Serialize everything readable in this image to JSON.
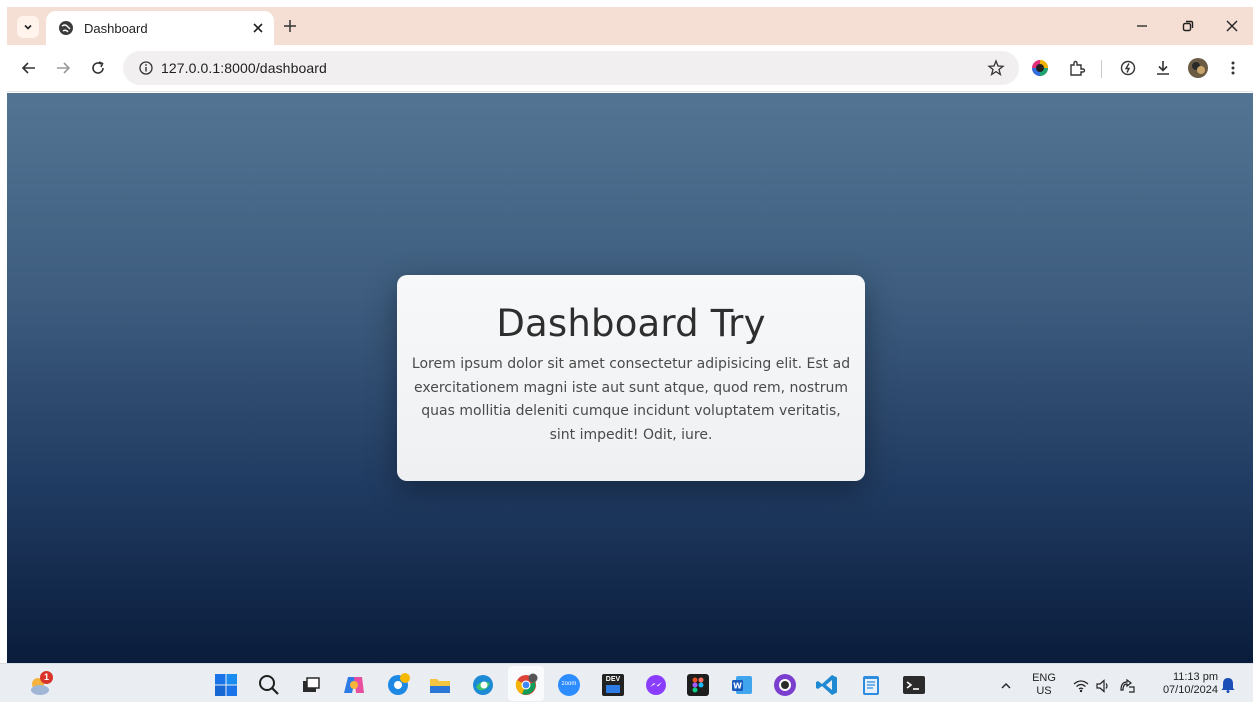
{
  "browser": {
    "tab": {
      "title": "Dashboard"
    },
    "address_bar": {
      "url": "127.0.0.1:8000/dashboard"
    }
  },
  "page": {
    "card": {
      "title": "Dashboard Try",
      "body": "Lorem ipsum dolor sit amet consectetur adipisicing elit. Est ad exercitationem magni iste aut sunt atque, quod rem, nostrum quas mollitia deleniti cumque incidunt voluptatem veritatis, sint impedit! Odit, iure."
    }
  },
  "taskbar": {
    "weather_badge": "1",
    "apps": [
      "start",
      "search",
      "task-view",
      "copilot",
      "chrome-canary",
      "file-explorer",
      "edge",
      "chrome",
      "zoom",
      "dev",
      "messenger",
      "figma",
      "word",
      "github",
      "vscode",
      "notepad",
      "terminal"
    ],
    "zoom_label": "zoom",
    "dev_label": "DEV",
    "language": {
      "line1": "ENG",
      "line2": "US"
    },
    "clock": {
      "time": "11:13 pm",
      "date": "07/10/2024"
    }
  },
  "colors": {
    "tabstrip": "#f5ded3",
    "gradient_top": "#537593",
    "gradient_bottom": "#0a1c3b",
    "card": "#f3f4f6"
  }
}
